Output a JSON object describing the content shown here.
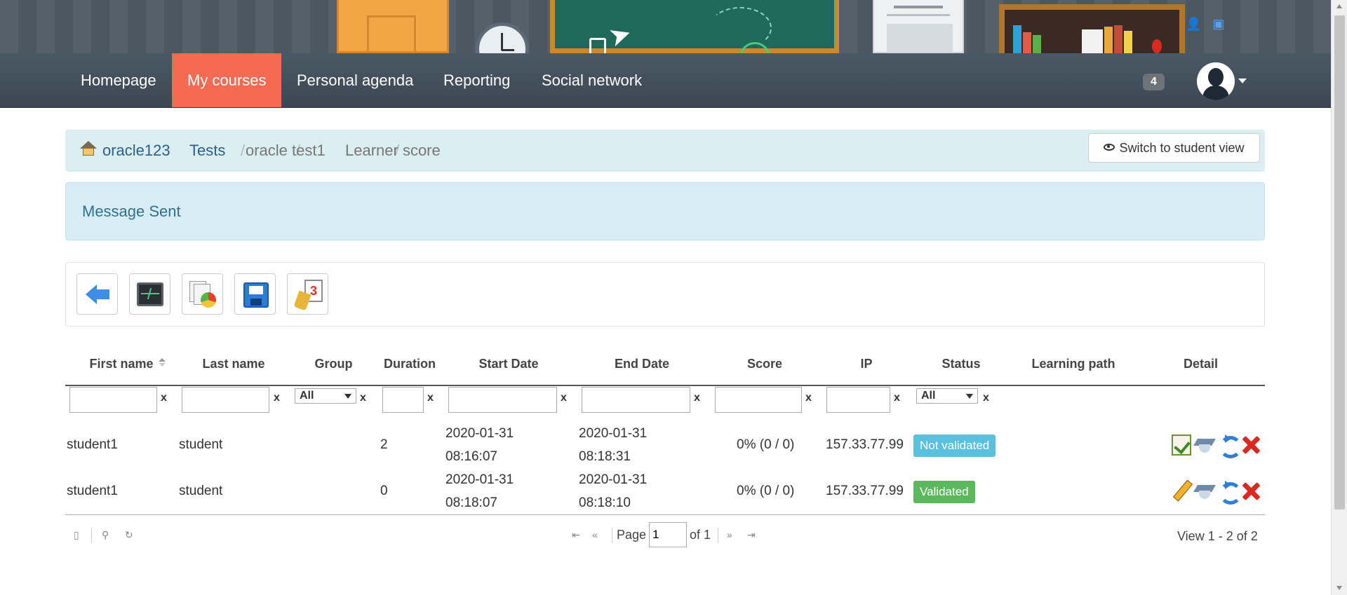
{
  "nav": {
    "items": [
      {
        "label": "Homepage",
        "active": false
      },
      {
        "label": "My courses",
        "active": true
      },
      {
        "label": "Personal agenda",
        "active": false
      },
      {
        "label": "Reporting",
        "active": false
      },
      {
        "label": "Social network",
        "active": false
      }
    ],
    "notification_count": "4",
    "active_color": "#f46a52",
    "bar_color": "#414e5a"
  },
  "breadcrumb": {
    "items": [
      {
        "label": "oracle123",
        "link": true
      },
      {
        "label": "Tests",
        "link": true
      },
      {
        "label": "oracle test1",
        "link": false
      },
      {
        "label": "Learner score",
        "link": false
      }
    ],
    "separator": "/",
    "home_icon": "home-icon"
  },
  "student_view_button": {
    "label": "Switch to student view",
    "icon": "eye-icon"
  },
  "alert": {
    "message": "Message Sent",
    "color": "#d9edf7"
  },
  "toolbar": {
    "buttons": [
      {
        "name": "back",
        "icon": "back-arrow-icon"
      },
      {
        "name": "monitor",
        "icon": "monitor-icon"
      },
      {
        "name": "reports",
        "icon": "report-chart-icon"
      },
      {
        "name": "save",
        "icon": "floppy-disk-icon"
      },
      {
        "name": "clean",
        "icon": "clean-results-icon"
      }
    ]
  },
  "grid": {
    "columns": [
      "First name",
      "Last name",
      "Group",
      "Duration",
      "Start Date",
      "End Date",
      "Score",
      "IP",
      "Status",
      "Learning path",
      "Detail"
    ],
    "filters": {
      "group_select": "All",
      "status_select": "All",
      "clear_label": "x"
    },
    "rows": [
      {
        "first_name": "student1",
        "last_name": "student",
        "duration": "2",
        "start_date": "2020-01-31",
        "start_time": "08:16:07",
        "end_date": "2020-01-31",
        "end_time": "08:18:31",
        "score": "0% (0 / 0)",
        "ip": "157.33.77.99",
        "status": "Not validated",
        "status_color": "#5bc0de",
        "actions": [
          "quiz-check-icon",
          "learner-hat-icon",
          "regenerate-icon",
          "delete-icon"
        ]
      },
      {
        "first_name": "student1",
        "last_name": "student",
        "duration": "0",
        "start_date": "2020-01-31",
        "start_time": "08:18:07",
        "end_date": "2020-01-31",
        "end_time": "08:18:10",
        "score": "0% (0 / 0)",
        "ip": "157.33.77.99",
        "status": "Validated",
        "status_color": "#5cb85c",
        "actions": [
          "edit-pencil-icon",
          "learner-hat-icon",
          "regenerate-icon",
          "delete-icon"
        ]
      }
    ]
  },
  "pager": {
    "page_label": "Page",
    "page_value": "1",
    "of_label": "of 1",
    "view_summary": "View 1 - 2 of 2"
  }
}
